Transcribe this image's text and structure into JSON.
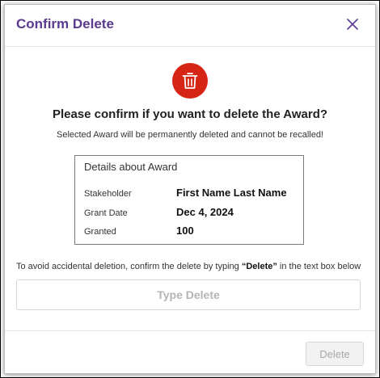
{
  "dialog": {
    "title": "Confirm Delete",
    "close_icon": "close-icon",
    "trash_icon": "trash-icon",
    "question": "Please confirm if you want to delete the Award?",
    "warning": "Selected Award will be permanently deleted and cannot be recalled!",
    "details": {
      "title": "Details about Award",
      "rows": [
        {
          "label": "Stakeholder",
          "value": "First Name Last Name"
        },
        {
          "label": "Grant Date",
          "value": "Dec 4, 2024"
        },
        {
          "label": "Granted",
          "value": "100"
        }
      ]
    },
    "instruction_prefix": "To avoid accidental deletion, confirm the delete by typing ",
    "instruction_keyword": "“Delete”",
    "instruction_suffix": " in the text box below",
    "input": {
      "value": "",
      "placeholder": "Type Delete"
    },
    "delete_button": "Delete",
    "accent_color": "#5b3a8e",
    "danger_color": "#d62515"
  }
}
